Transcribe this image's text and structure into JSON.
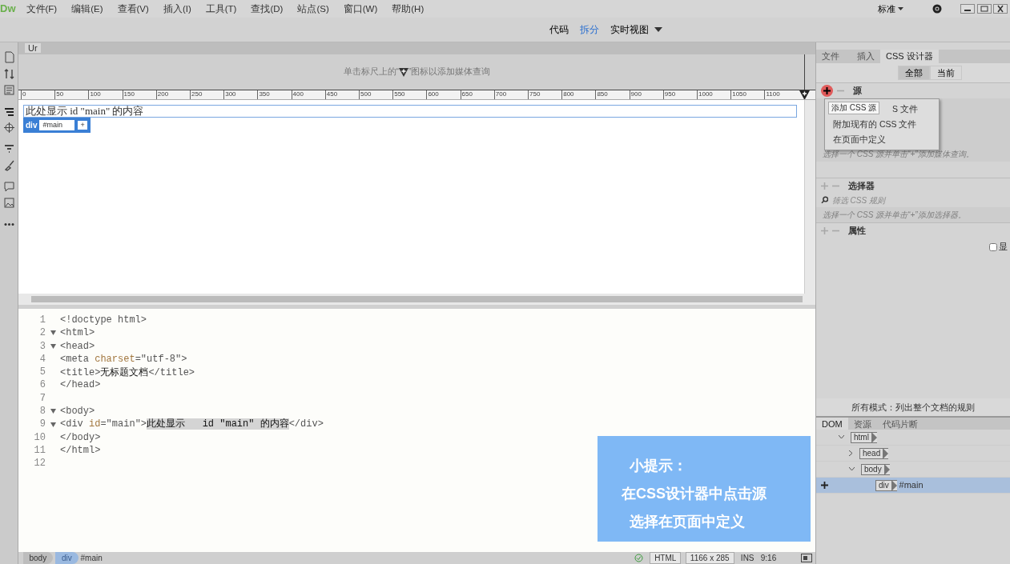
{
  "app_logo": "Dw",
  "menu": [
    "文件(F)",
    "编辑(E)",
    "查看(V)",
    "插入(I)",
    "工具(T)",
    "查找(D)",
    "站点(S)",
    "窗口(W)",
    "帮助(H)"
  ],
  "view_modes": [
    {
      "label": "代码",
      "selected": false
    },
    {
      "label": "拆分",
      "selected": true
    },
    {
      "label": "实时视图",
      "selected": false
    }
  ],
  "workspace": "标准",
  "document_tab": "Ur",
  "media_hint": {
    "before": "单击标尺上的“",
    "after": "”图标以添加媒体查询"
  },
  "ruler": [
    "0",
    "50",
    "100",
    "150",
    "200",
    "250",
    "300",
    "350",
    "400",
    "450",
    "500",
    "550",
    "600",
    "650",
    "700",
    "750",
    "800",
    "850",
    "900",
    "950",
    "1000",
    "1050",
    "1100"
  ],
  "design_view": {
    "content": "此处显示 id \"main\" 的内容",
    "tag": "div",
    "id": "#main",
    "add": "+"
  },
  "code_lines": [
    {
      "number": "1",
      "fold": false,
      "segments": [
        {
          "kind": "punct",
          "text": "<!doctype html>"
        }
      ]
    },
    {
      "number": "2",
      "fold": true,
      "segments": [
        {
          "kind": "punct",
          "text": "<html>"
        }
      ]
    },
    {
      "number": "3",
      "fold": true,
      "segments": [
        {
          "kind": "punct",
          "text": "<head>"
        }
      ]
    },
    {
      "number": "4",
      "fold": false,
      "segments": [
        {
          "kind": "punct",
          "text": "<meta "
        },
        {
          "kind": "attr",
          "text": "charset"
        },
        {
          "kind": "punct",
          "text": "=\"utf-8\">"
        }
      ]
    },
    {
      "number": "5",
      "fold": false,
      "segments": [
        {
          "kind": "punct",
          "text": "<title>"
        },
        {
          "kind": "text",
          "text": "无标题文档"
        },
        {
          "kind": "punct",
          "text": "</title>"
        }
      ]
    },
    {
      "number": "6",
      "fold": false,
      "segments": [
        {
          "kind": "punct",
          "text": "</head>"
        }
      ]
    },
    {
      "number": "7",
      "fold": false
    },
    {
      "number": "8",
      "fold": true,
      "segments": [
        {
          "kind": "punct",
          "text": "<body>"
        }
      ]
    },
    {
      "number": "9",
      "fold": true,
      "segments": [
        {
          "kind": "punct",
          "text": "<div "
        },
        {
          "kind": "attr",
          "text": "id"
        },
        {
          "kind": "punct",
          "text": "=\"main\">"
        },
        {
          "kind": "sel",
          "text": "此处显示   id \"main\" 的内容"
        },
        {
          "kind": "punct",
          "text": "</div>"
        }
      ]
    },
    {
      "number": "10",
      "fold": false,
      "segments": [
        {
          "kind": "punct",
          "text": "</body>"
        }
      ]
    },
    {
      "number": "11",
      "fold": false,
      "segments": [
        {
          "kind": "punct",
          "text": "</html>"
        }
      ]
    },
    {
      "number": "12",
      "fold": false
    }
  ],
  "status_bar": {
    "tags": [
      {
        "label": "body",
        "selected": false
      },
      {
        "label": "div",
        "selected": true
      }
    ],
    "element_id": "#main",
    "language": "HTML",
    "size": "1166 x 285",
    "mode": "INS",
    "position": "9:16"
  },
  "panel": {
    "tabs": [
      {
        "label": "文件",
        "selected": false
      },
      {
        "label": "插入",
        "selected": false
      },
      {
        "label": "CSS 设计器",
        "selected": true
      }
    ],
    "filters": [
      {
        "label": "全部",
        "selected": true
      },
      {
        "label": "当前",
        "selected": false
      }
    ],
    "sources": {
      "title": "源",
      "hint": "选择一个 CSS 源并单击“+”添加媒体查询。"
    },
    "source_menu": {
      "tooltip": "添加 CSS 源",
      "items": [
        "S 文件",
        "附加现有的 CSS 文件",
        "在页面中定义"
      ]
    },
    "selectors": {
      "title": "选择器",
      "placeholder": "筛选 CSS 规则",
      "hint": "选择一个 CSS 源并单击“+”添加选择器。"
    },
    "properties": {
      "title": "属性",
      "show_set": {
        "label": "显",
        "checked": false
      }
    },
    "footer": "所有模式：列出整个文档的规则"
  },
  "dom_panel": {
    "tabs": [
      {
        "label": "DOM",
        "selected": true
      },
      {
        "label": "资源",
        "selected": false
      },
      {
        "label": "代码片断",
        "selected": false
      }
    ],
    "tree": [
      {
        "tag": "html",
        "expanded": true,
        "children": [
          {
            "tag": "head",
            "expanded": false
          },
          {
            "tag": "body",
            "expanded": true,
            "children": [
              {
                "tag": "div",
                "id": "#main",
                "selected": true
              }
            ]
          }
        ]
      }
    ]
  },
  "tip": {
    "title": "小提示：",
    "lines": [
      "在CSS设计器中点击源",
      "选择在页面中定义"
    ]
  }
}
